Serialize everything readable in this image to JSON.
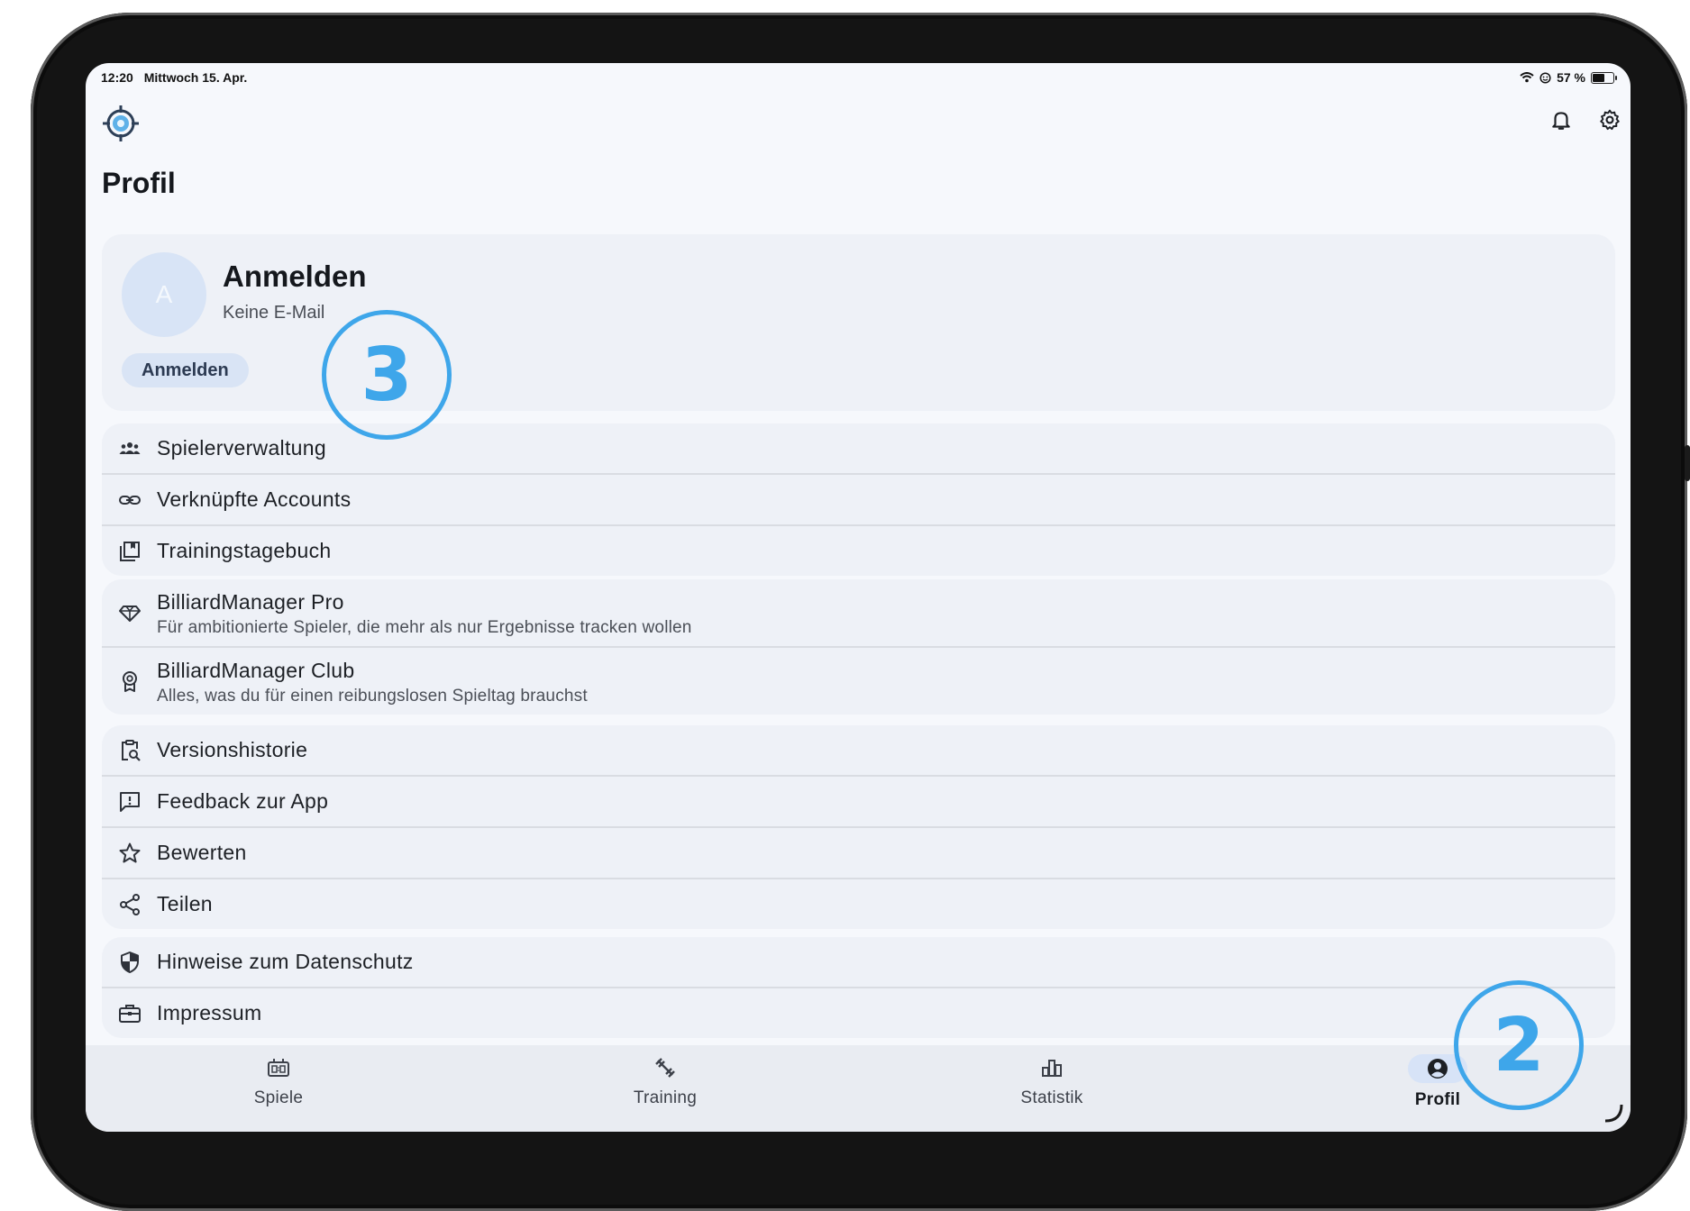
{
  "status_bar": {
    "time": "12:20",
    "date": "Mittwoch 15. Apr.",
    "battery": "57 %"
  },
  "header": {
    "title": "Profil"
  },
  "profile": {
    "avatar_initial": "A",
    "name": "Anmelden",
    "email": "Keine E-Mail",
    "login_button": "Anmelden"
  },
  "groups": [
    {
      "items": [
        {
          "label": "Spielerverwaltung",
          "icon": "players-icon"
        },
        {
          "label": "Verknüpfte Accounts",
          "icon": "link-icon"
        },
        {
          "label": "Trainingstagebuch",
          "icon": "journal-icon"
        }
      ]
    },
    {
      "items": [
        {
          "label": "BilliardManager Pro",
          "sub": "Für ambitionierte Spieler, die mehr als nur Ergebnisse tracken wollen",
          "icon": "diamond-icon"
        },
        {
          "label": "BilliardManager Club",
          "sub": "Alles, was du für einen reibungslosen Spieltag brauchst",
          "icon": "award-icon"
        }
      ]
    },
    {
      "items": [
        {
          "label": "Versionshistorie",
          "icon": "history-search-icon"
        },
        {
          "label": "Feedback zur App",
          "icon": "feedback-icon"
        },
        {
          "label": "Bewerten",
          "icon": "star-icon"
        },
        {
          "label": "Teilen",
          "icon": "share-icon"
        }
      ]
    },
    {
      "items": [
        {
          "label": "Hinweise zum Datenschutz",
          "icon": "shield-icon"
        },
        {
          "label": "Impressum",
          "icon": "briefcase-icon"
        }
      ]
    }
  ],
  "bottom_nav": [
    {
      "label": "Spiele",
      "icon": "scoreboard-icon"
    },
    {
      "label": "Training",
      "icon": "training-icon"
    },
    {
      "label": "Statistik",
      "icon": "bar-chart-icon"
    },
    {
      "label": "Profil",
      "icon": "account-icon",
      "active": true
    }
  ],
  "annotations": {
    "badge_a": "3",
    "badge_b": "2"
  },
  "colors": {
    "accent": "#3ea6ea",
    "pill": "#d9e4f5",
    "card": "#eef1f7"
  }
}
